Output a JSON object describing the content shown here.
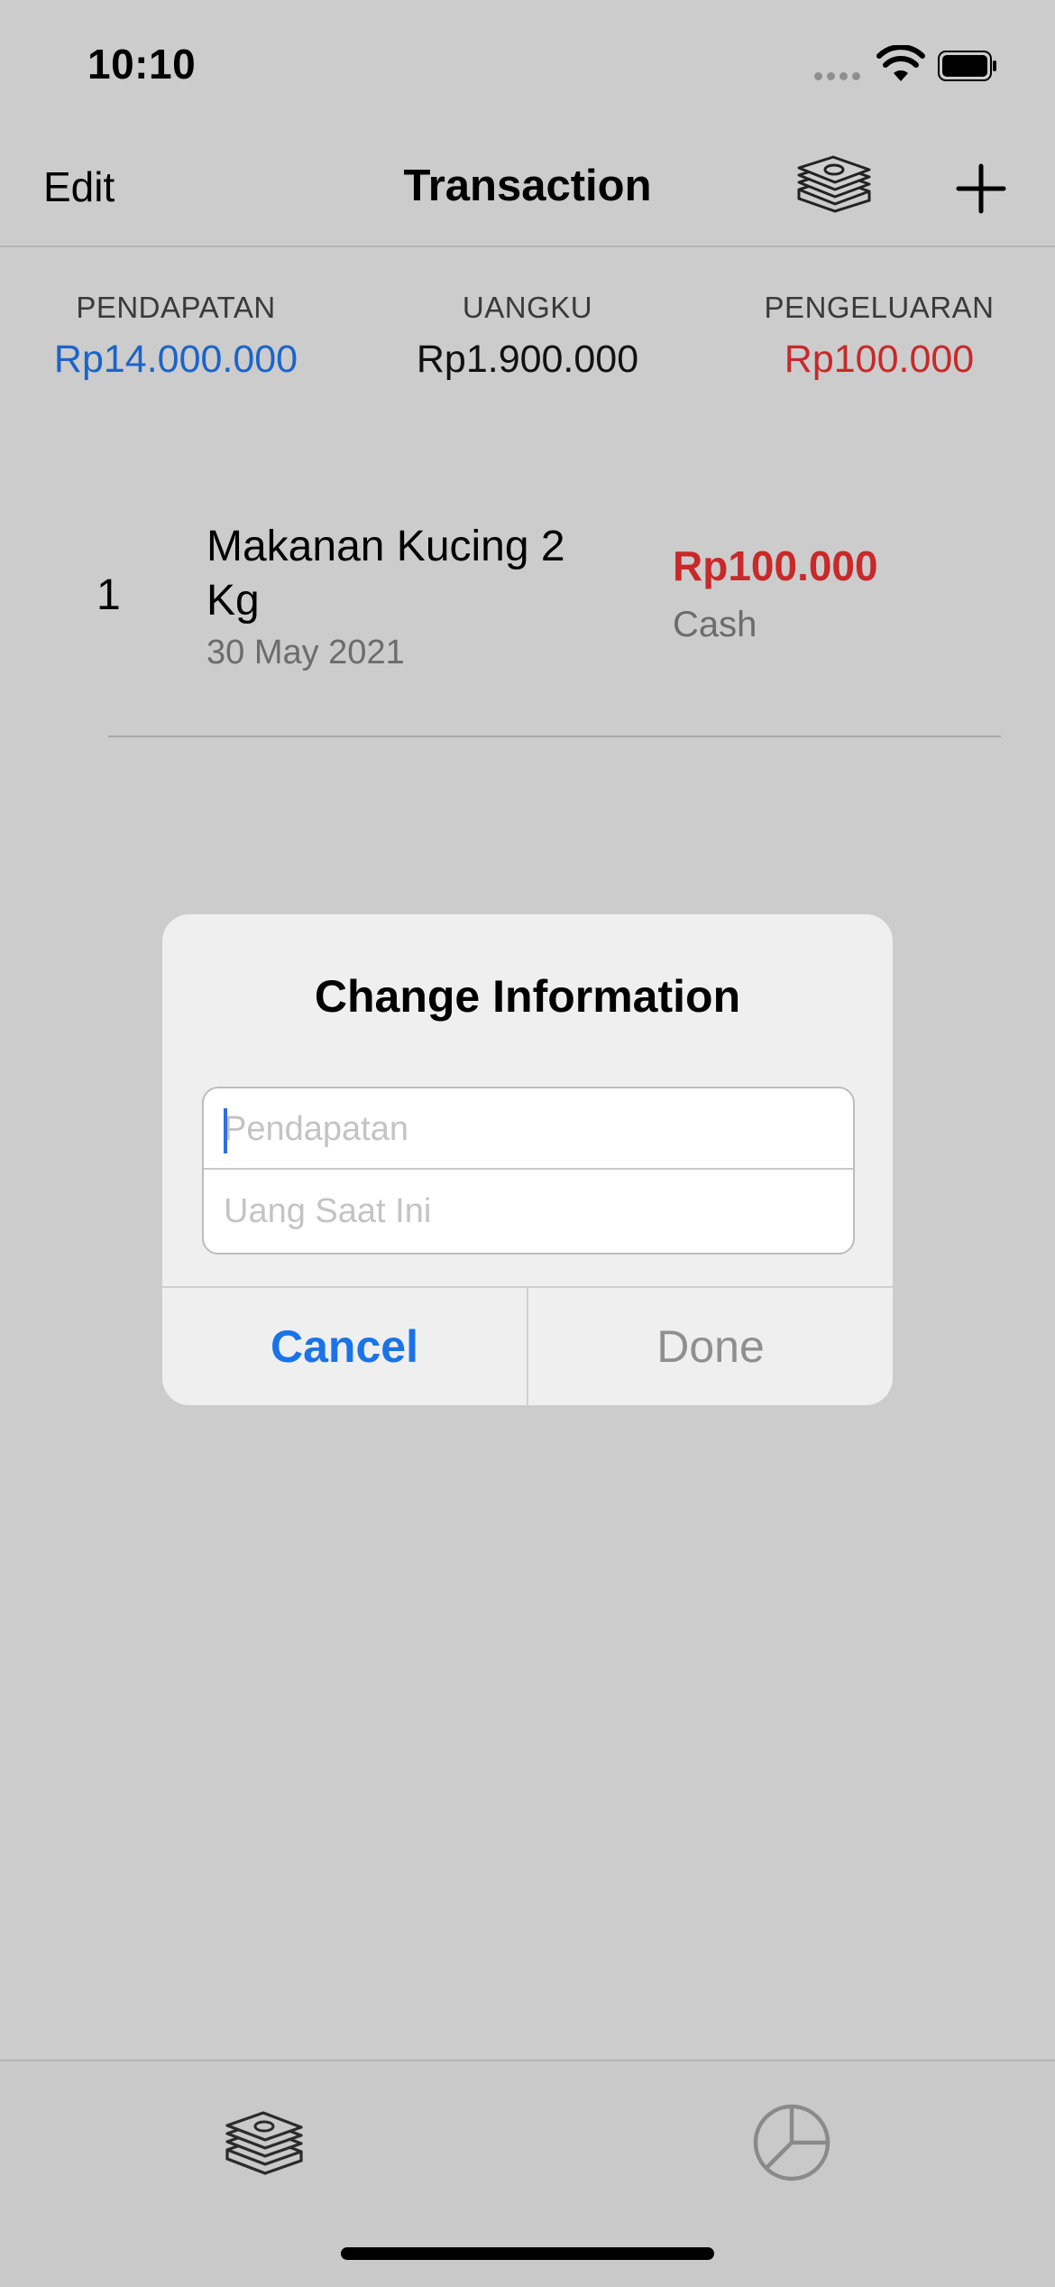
{
  "status_bar": {
    "time": "10:10"
  },
  "nav": {
    "edit_label": "Edit",
    "title": "Transaction",
    "icons": [
      "money-stack-icon",
      "plus-icon"
    ]
  },
  "summary": {
    "income_label": "PENDAPATAN",
    "income_value": "Rp14.000.000",
    "balance_label": "UANGKU",
    "balance_value": "Rp1.900.000",
    "expense_label": "PENGELUARAN",
    "expense_value": "Rp100.000"
  },
  "transactions": [
    {
      "index": "1",
      "name": "Makanan Kucing 2 Kg",
      "date": "30 May 2021",
      "amount": "Rp100.000",
      "method": "Cash"
    }
  ],
  "alert": {
    "title": "Change Information",
    "field1_placeholder": "Pendapatan",
    "field2_placeholder": "Uang Saat Ini",
    "cancel_label": "Cancel",
    "done_label": "Done"
  },
  "tab_bar": {
    "items": [
      "money-stack-icon",
      "pie-chart-icon"
    ]
  },
  "colors": {
    "income": "#1b64c9",
    "expense": "#c8292a",
    "accent": "#1a73e8",
    "background": "#cccccc"
  }
}
